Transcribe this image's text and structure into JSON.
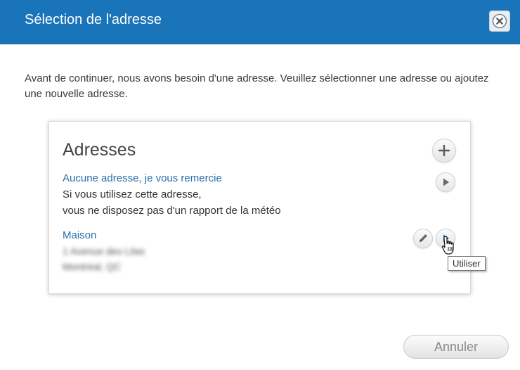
{
  "dialog": {
    "title": "Sélection de l'adresse",
    "intro": "Avant de continuer, nous avons besoin d'une adresse. Veuillez sélectionner une adresse ou ajoutez une nouvelle adresse."
  },
  "addresses": {
    "heading": "Adresses",
    "none_option": {
      "name": "Aucune adresse, je vous remercie",
      "line1": "Si vous utilisez cette adresse,",
      "line2": "vous ne disposez pas d'un rapport de la météo"
    },
    "home": {
      "name": "Maison",
      "line1": "1 Avenue des Lilas",
      "line2": "Montréal, QC"
    }
  },
  "tooltip": "Utiliser",
  "footer": {
    "cancel_label": "Annuler"
  },
  "icons": {
    "close": "close-icon",
    "add": "plus-icon",
    "use": "play-icon",
    "edit": "pencil-icon",
    "cursor": "hand-pointer-icon"
  },
  "colors": {
    "titlebar": "#1a74b9",
    "link": "#2a6eaa",
    "use_active": "#1a74b9"
  }
}
